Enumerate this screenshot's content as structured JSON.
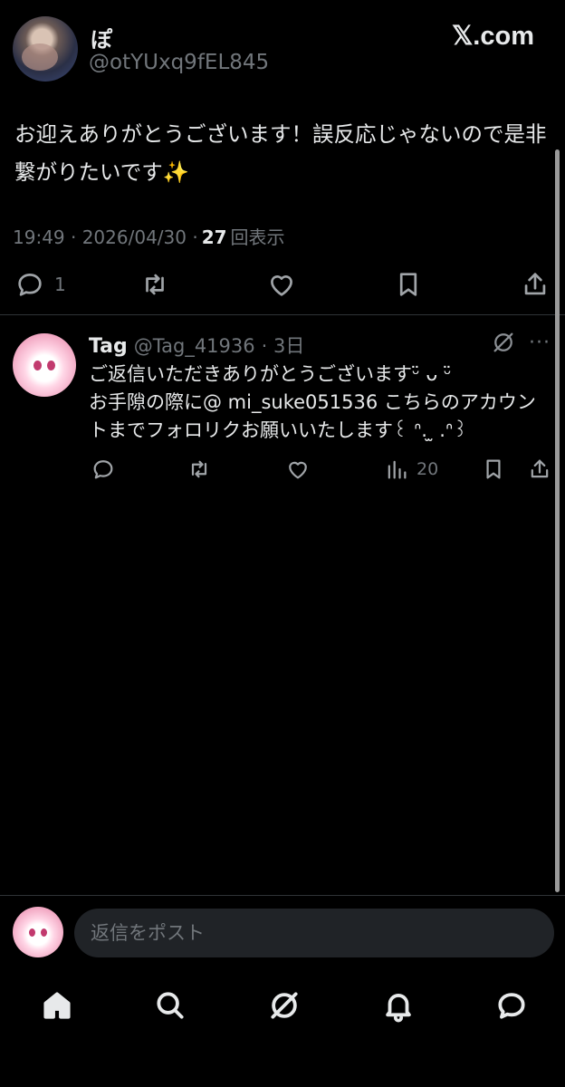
{
  "brand": "𝕏.com",
  "main_tweet": {
    "display_name": "ぽ",
    "handle": "@otYUxq9fEL845",
    "text": "お迎えありがとうございます！誤反応じゃないので是非繋がりたいです✨",
    "time": "19:49 · 2026/04/30 ·",
    "view_count": "27",
    "view_label": "回表示",
    "reply_count": "1",
    "icons": {
      "reply": "reply-icon",
      "retweet": "retweet-icon",
      "like": "heart-icon",
      "bookmark": "bookmark-icon",
      "share": "share-icon"
    }
  },
  "reply": {
    "display_name": "Tag",
    "handle": "@Tag_41936",
    "time": "· 3日",
    "more": "···",
    "text_line1": "ご返信いただきありがとうございますᵕ̈ ᴗ ᵕ̈",
    "text_line2": "お手隙の際に@ mi_suke051536 こちらのアカウントまでフォロリクお願いいたします꒰ ᐢ. ̫ .ᐢ꒱",
    "view_count": "20"
  },
  "composer": {
    "placeholder": "返信をポスト"
  },
  "nav": {
    "items": [
      "home-icon",
      "search-icon",
      "grok-icon",
      "notifications-icon",
      "messages-icon"
    ]
  },
  "colors": {
    "background": "#000000",
    "text": "#e7e9ea",
    "muted": "#71767b",
    "divider": "#2f3336",
    "input_bg": "#202327"
  }
}
